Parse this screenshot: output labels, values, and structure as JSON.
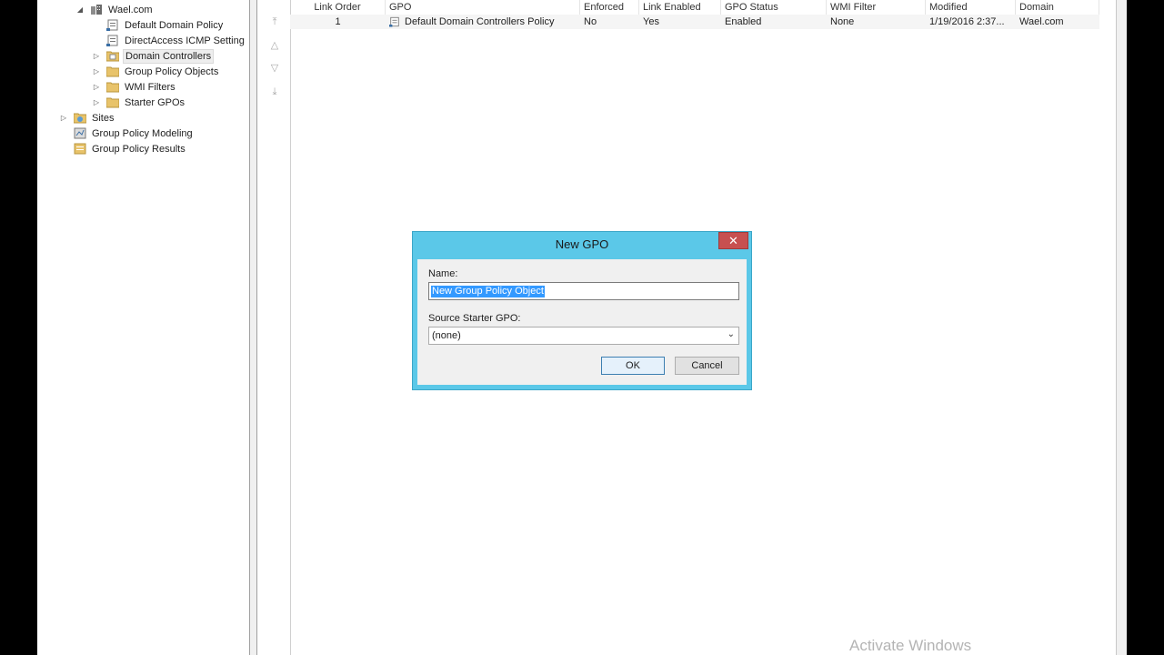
{
  "tree": {
    "domain": "Wael.com",
    "items": [
      {
        "label": "Default Domain Policy"
      },
      {
        "label": "DirectAccess ICMP Setting"
      },
      {
        "label": "Domain Controllers"
      },
      {
        "label": "Group Policy Objects"
      },
      {
        "label": "WMI Filters"
      },
      {
        "label": "Starter GPOs"
      }
    ],
    "root_items": [
      {
        "label": "Sites"
      },
      {
        "label": "Group Policy Modeling"
      },
      {
        "label": "Group Policy Results"
      }
    ]
  },
  "table": {
    "headers": [
      "Link Order",
      "GPO",
      "Enforced",
      "Link Enabled",
      "GPO Status",
      "WMI Filter",
      "Modified",
      "Domain"
    ],
    "rows": [
      {
        "link_order": "1",
        "gpo": "Default Domain Controllers Policy",
        "enforced": "No",
        "link_enabled": "Yes",
        "gpo_status": "Enabled",
        "wmi_filter": "None",
        "modified": "1/19/2016 2:37...",
        "domain": "Wael.com"
      }
    ]
  },
  "dialog": {
    "title": "New GPO",
    "close": "✕",
    "name_label": "Name:",
    "name_value": "New Group Policy Object",
    "starter_label": "Source Starter GPO:",
    "starter_value": "(none)",
    "ok": "OK",
    "cancel": "Cancel"
  },
  "watermark": "Activate Windows"
}
